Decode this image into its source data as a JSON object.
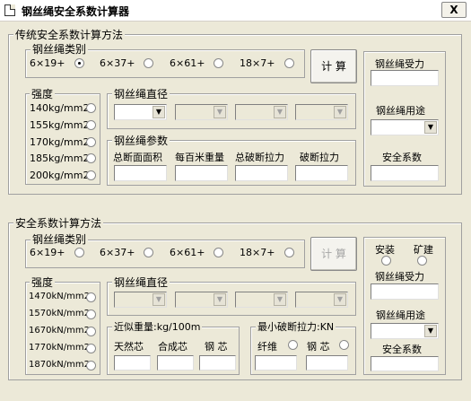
{
  "window": {
    "title": "钢丝绳安全系数计算器",
    "close_label": "X"
  },
  "traditional": {
    "title": "传统安全系数计算方法",
    "rope_type": {
      "title": "钢丝绳类别",
      "options": [
        "6×19+",
        "6×37+",
        "6×61+",
        "18×7+"
      ],
      "selected_index": 0
    },
    "strength": {
      "title": "强度",
      "options": [
        "140kg/mm2",
        "155kg/mm2",
        "170kg/mm2",
        "185kg/mm2",
        "200kg/mm2"
      ]
    },
    "diameter": {
      "title": "钢丝绳直径"
    },
    "params": {
      "title": "钢丝绳参数",
      "labels": [
        "总断面面积",
        "每百米重量",
        "总破断拉力",
        "破断拉力"
      ]
    },
    "calc_button": "计 算",
    "force_label": "钢丝绳受力",
    "usage_label": "钢丝绳用途",
    "safety_label": "安全系数"
  },
  "safety": {
    "title": "安全系数计算方法",
    "rope_type": {
      "title": "钢丝绳类别",
      "options": [
        "6×19+",
        "6×37+",
        "6×61+",
        "18×7+"
      ]
    },
    "strength": {
      "title": "强度",
      "options": [
        "1470kN/mm2",
        "1570kN/mm2",
        "1670kN/mm2",
        "1770kN/mm2",
        "1870kN/mm2"
      ]
    },
    "diameter": {
      "title": "钢丝绳直径"
    },
    "weight": {
      "title": "近似重量:kg/100m",
      "labels": [
        "天然芯",
        "合成芯",
        "钢 芯"
      ]
    },
    "min_break": {
      "title": "最小破断拉力:KN",
      "fiber": "纤维",
      "steel": "钢 芯"
    },
    "calc_button": "计 算",
    "install_label": "安装",
    "mine_label": "矿建",
    "force_label": "钢丝绳受力",
    "usage_label": "钢丝绳用途",
    "safety_label": "安全系数"
  }
}
